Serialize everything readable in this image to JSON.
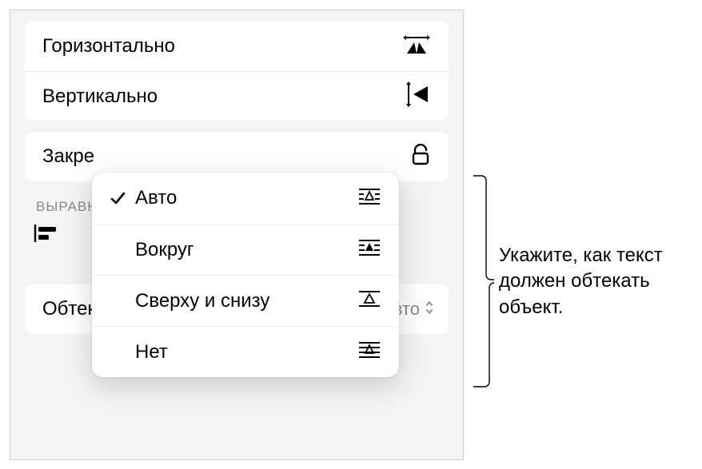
{
  "flip": {
    "horizontal_label": "Горизонтально",
    "vertical_label": "Вертикально"
  },
  "lock": {
    "label_partial": "Закре"
  },
  "align_caption_partial": "ВЫРАВН",
  "wrap_row": {
    "label": "Обтекание текстом",
    "value": "Авто"
  },
  "popover": {
    "items": [
      {
        "label": "Авто",
        "checked": true,
        "icon": "wrap-auto-icon"
      },
      {
        "label": "Вокруг",
        "checked": false,
        "icon": "wrap-around-icon"
      },
      {
        "label": "Сверху и снизу",
        "checked": false,
        "icon": "wrap-topbottom-icon"
      },
      {
        "label": "Нет",
        "checked": false,
        "icon": "wrap-none-icon"
      }
    ]
  },
  "callout": "Укажите, как текст должен обтекать объект."
}
